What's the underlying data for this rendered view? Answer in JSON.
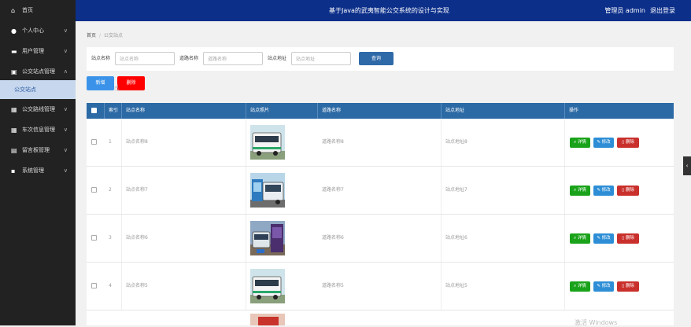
{
  "header": {
    "title": "基于Java的武夷智能公交系统的设计与实现",
    "user": "管理员 admin",
    "logout": "退出登录"
  },
  "sidebar": {
    "items": [
      {
        "label": "首页",
        "icon": "home-icon"
      },
      {
        "label": "个人中心",
        "icon": "user-icon"
      },
      {
        "label": "用户管理",
        "icon": "folder-icon"
      },
      {
        "label": "公交站点管理",
        "icon": "bus-icon"
      },
      {
        "label": "公交路线管理",
        "icon": "grid-icon"
      },
      {
        "label": "车次信息管理",
        "icon": "grid-icon"
      },
      {
        "label": "留言板管理",
        "icon": "message-icon"
      },
      {
        "label": "系统管理",
        "icon": "settings-icon"
      }
    ],
    "sub_item": "公交站点"
  },
  "breadcrumb": {
    "home": "首页",
    "sep": "/",
    "current": "公交站点"
  },
  "search": {
    "station_label": "站点名称",
    "station_placeholder": "站点名称",
    "route_label": "道路名称",
    "route_placeholder": "道路名称",
    "address_label": "站点地址",
    "address_placeholder": "站点地址",
    "button": "查询"
  },
  "actions": {
    "add": "新增",
    "delete": "删除"
  },
  "table": {
    "headers": [
      "索引",
      "站点名称",
      "站点照片",
      "道路名称",
      "站点地址",
      "操作"
    ],
    "rows": [
      {
        "index": "1",
        "name": "站点名称8",
        "route": "道路名称8",
        "address": "站点地址8"
      },
      {
        "index": "2",
        "name": "站点名称7",
        "route": "道路名称7",
        "address": "站点地址7"
      },
      {
        "index": "3",
        "name": "站点名称6",
        "route": "道路名称6",
        "address": "站点地址6"
      },
      {
        "index": "4",
        "name": "站点名称5",
        "route": "道路名称5",
        "address": "站点地址5"
      }
    ],
    "op_detail": "详情",
    "op_edit": "修改",
    "op_delete": "删除"
  },
  "watermark": "激活 Windows"
}
